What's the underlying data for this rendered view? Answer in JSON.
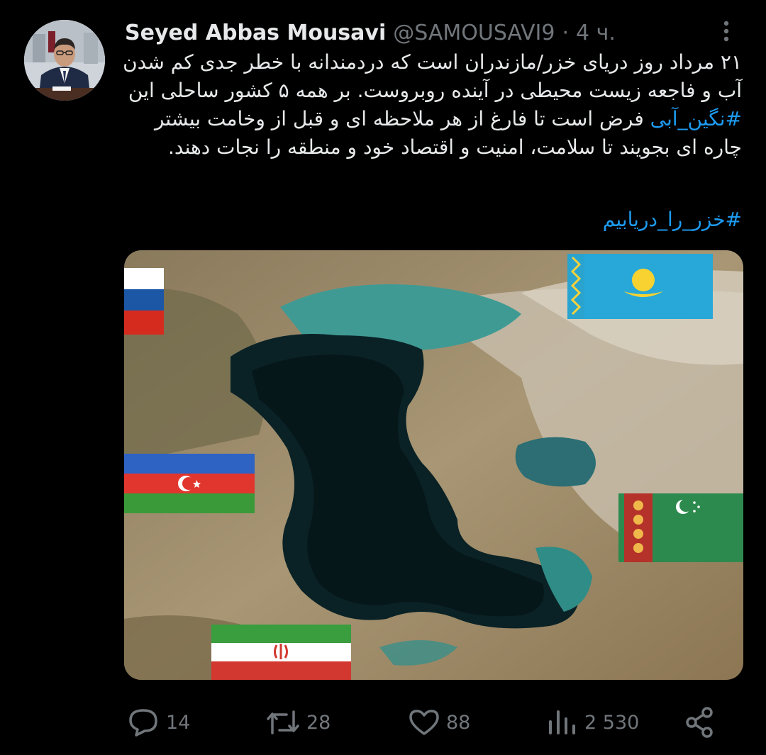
{
  "tweet": {
    "author_name": "Seyed Abbas Mousavi",
    "handle": "@SAMOUSAVI9",
    "separator": "·",
    "time": "4 ч.",
    "body_lines": [
      "۲۱ مرداد روز دریای خزر/مازندران است که دردمندانه با خطر جدی کم شدن",
      "آب و فاجعه زیست محیطی در آینده روبروست. بر همه ۵ کشور ساحلی این",
      "فرض است تا فارغ از هر ملاحظه ای و قبل از وخامت بیشتر",
      "چاره ای بجویند تا سلامت، امنیت و اقتصاد خود و منطقه را نجات دهند."
    ],
    "inline_hashtag": "#نگین_آبی",
    "hashtag": "#خزر_را_دریابیم",
    "media": {
      "subject": "Caspian Sea satellite map with flags",
      "flags": [
        "russia",
        "kazakhstan",
        "azerbaijan",
        "turkmenistan",
        "iran"
      ]
    }
  },
  "actions": {
    "reply_count": "14",
    "retweet_count": "28",
    "like_count": "88",
    "views_count": "2 530"
  },
  "icons": {
    "more": "more-vertical-icon",
    "reply": "reply-icon",
    "retweet": "retweet-icon",
    "like": "heart-icon",
    "views": "views-icon",
    "share": "share-icon"
  },
  "colors": {
    "background": "#000000",
    "text": "#e7e9ea",
    "muted": "#71767b",
    "link": "#1d9bf0"
  }
}
